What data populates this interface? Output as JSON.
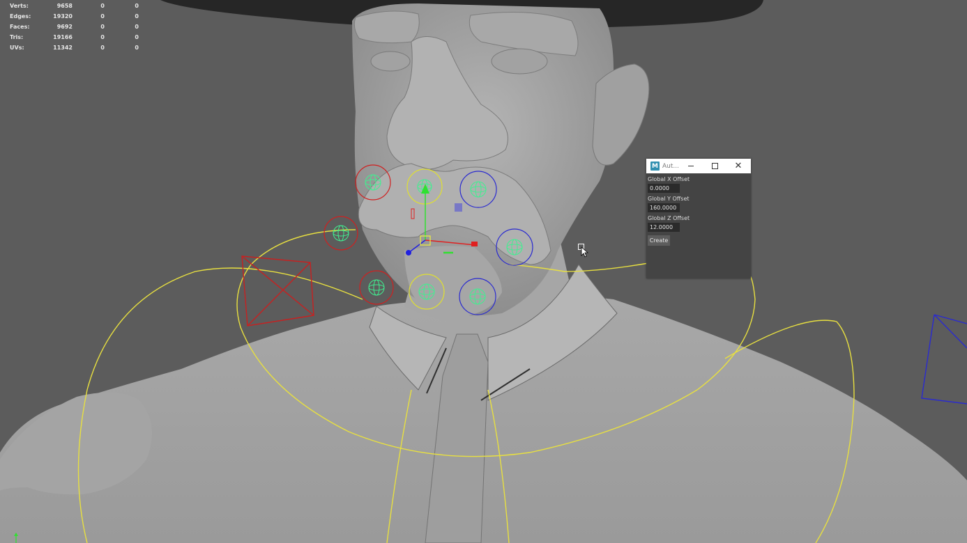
{
  "hud": {
    "rows": [
      {
        "label": "Verts:",
        "v1": "9658",
        "v2": "0",
        "v3": "0"
      },
      {
        "label": "Edges:",
        "v1": "19320",
        "v2": "0",
        "v3": "0"
      },
      {
        "label": "Faces:",
        "v1": "9692",
        "v2": "0",
        "v3": "0"
      },
      {
        "label": "Tris:",
        "v1": "19166",
        "v2": "0",
        "v3": "0"
      },
      {
        "label": "UVs:",
        "v1": "11342",
        "v2": "0",
        "v3": "0"
      }
    ]
  },
  "tool_window": {
    "app_icon_letter": "M",
    "title": "Aut...",
    "close_glyph": "✕",
    "fields": [
      {
        "label": "Global X Offset",
        "value": "0.0000"
      },
      {
        "label": "Global Y Offset",
        "value": "160.0000"
      },
      {
        "label": "Global Z Offset",
        "value": "12.0000"
      }
    ],
    "create_label": "Create"
  },
  "colors": {
    "viewport_bg": "#5c5c5c",
    "mesh": "#9c9c9c",
    "curve_yellow": "#e8e040",
    "ctrl_red": "#d02020",
    "ctrl_blue": "#2a2ad0",
    "ctrl_yellow": "#e0e030",
    "joint_green": "#40f090"
  }
}
